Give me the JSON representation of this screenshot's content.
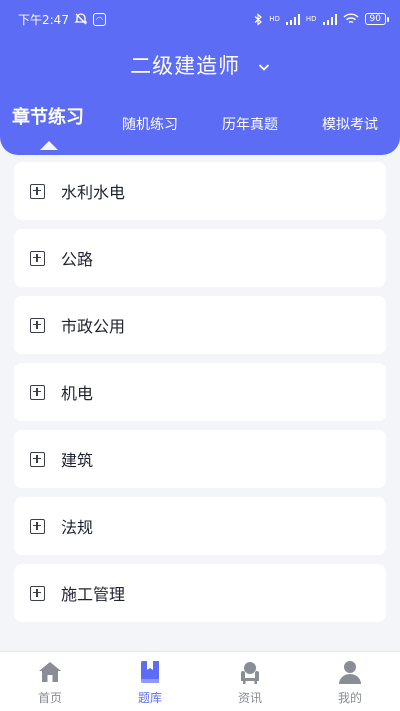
{
  "status_bar": {
    "time": "下午2:47",
    "signal1": "HD",
    "signal2": "HD",
    "battery": "90"
  },
  "header": {
    "title": "二级建造师"
  },
  "tabs": [
    {
      "label": "章节练习",
      "active": true
    },
    {
      "label": "随机练习",
      "active": false
    },
    {
      "label": "历年真题",
      "active": false
    },
    {
      "label": "模拟考试",
      "active": false
    }
  ],
  "chapters": [
    {
      "label": "水利水电"
    },
    {
      "label": "公路"
    },
    {
      "label": "市政公用"
    },
    {
      "label": "机电"
    },
    {
      "label": "建筑"
    },
    {
      "label": "法规"
    },
    {
      "label": "施工管理"
    }
  ],
  "bottom_nav": [
    {
      "label": "首页",
      "icon": "home-icon",
      "active": false
    },
    {
      "label": "题库",
      "icon": "book-icon",
      "active": true
    },
    {
      "label": "资讯",
      "icon": "news-icon",
      "active": false
    },
    {
      "label": "我的",
      "icon": "profile-icon",
      "active": false
    }
  ],
  "colors": {
    "accent": "#5d6cf4",
    "background": "#f4f5f8",
    "inactive_nav": "#8a8d96"
  }
}
